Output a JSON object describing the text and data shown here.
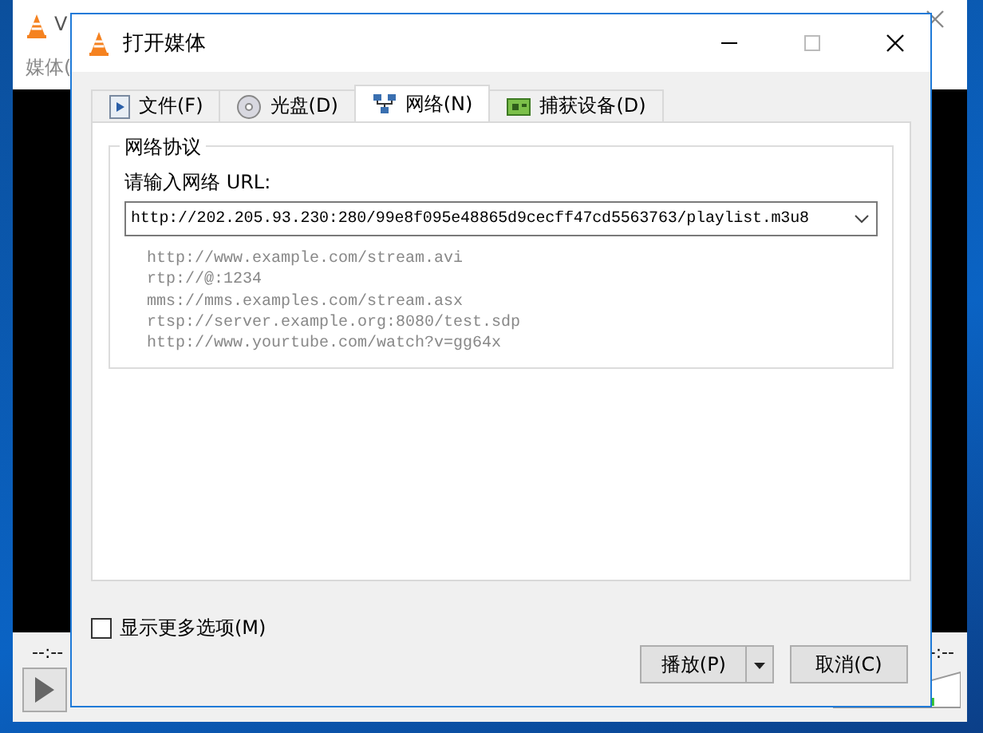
{
  "background_window": {
    "title": "V",
    "menu": [
      "媒体("
    ],
    "elapsed": "--:--",
    "remaining": "-:--",
    "volume": {
      "level": 0.8
    }
  },
  "dialog": {
    "title": "打开媒体",
    "tabs": [
      {
        "label": "文件(F)",
        "kind": "file",
        "selected": false
      },
      {
        "label": "光盘(D)",
        "kind": "disc",
        "selected": false
      },
      {
        "label": "网络(N)",
        "kind": "network",
        "selected": true
      },
      {
        "label": "捕获设备(D)",
        "kind": "capture",
        "selected": false
      }
    ],
    "group_title": "网络协议",
    "url_label": "请输入网络 URL:",
    "url_value": "http://202.205.93.230:280/99e8f095e48865d9cecff47cd5563763/playlist.m3u8",
    "examples": [
      "http://www.example.com/stream.avi",
      "rtp://@:1234",
      "mms://mms.examples.com/stream.asx",
      "rtsp://server.example.org:8080/test.sdp",
      "http://www.yourtube.com/watch?v=gg64x"
    ],
    "show_more": {
      "label": "显示更多选项(M)",
      "checked": false
    },
    "buttons": [
      {
        "label": "播放(P)",
        "kind": "split"
      },
      {
        "label": "取消(C)",
        "kind": "plain"
      }
    ]
  }
}
